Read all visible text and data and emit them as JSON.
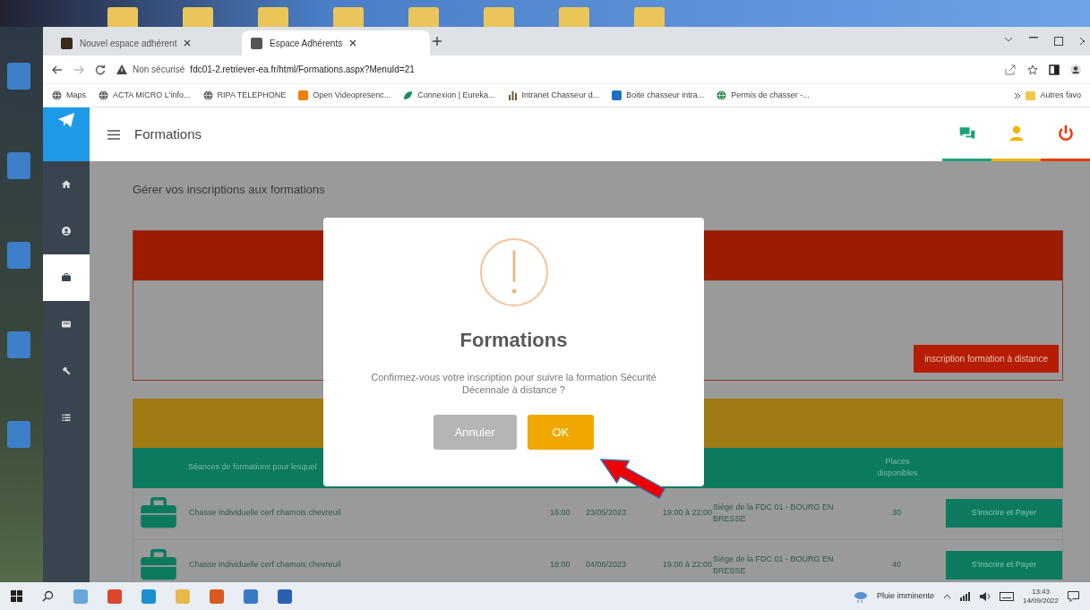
{
  "browser": {
    "tabs": [
      {
        "title": "Nouvel espace adhérent",
        "selected": false
      },
      {
        "title": "Espace Adhérents",
        "selected": true
      }
    ],
    "security": "Non sécurisé",
    "url": "fdc01-2.retriever-ea.fr/html/Formations.aspx?MenuId=21",
    "bookmarks": [
      {
        "label": "Maps",
        "kind": "globe",
        "color": "#5f6368"
      },
      {
        "label": "ACTA MICRO L'info...",
        "kind": "globe",
        "color": "#5f6368"
      },
      {
        "label": "RIPA TELEPHONE",
        "kind": "globe",
        "color": "#5f6368"
      },
      {
        "label": "Open Videopresenc...",
        "kind": "square",
        "color": "#f07c00"
      },
      {
        "label": "Connexion | Eureka...",
        "kind": "leaf",
        "color": "#1a8f5a"
      },
      {
        "label": "Intranet Chasseur d...",
        "kind": "chart",
        "color": "#6b5a2a"
      },
      {
        "label": "Boite chasseur intra...",
        "kind": "square",
        "color": "#1f6fc4"
      },
      {
        "label": "Permis de chasser -...",
        "kind": "globe",
        "color": "#2a8a4a"
      }
    ],
    "other_bookmarks": "Autres favo"
  },
  "app": {
    "sidebar": {
      "items": [
        {
          "selected": false
        },
        {
          "selected": false
        },
        {
          "selected": true
        },
        {
          "selected": false
        },
        {
          "selected": false
        },
        {
          "selected": false
        }
      ]
    },
    "header": {
      "title": "Formations",
      "actions": [
        {
          "color": "#1aa37a"
        },
        {
          "color": "#f0b400"
        },
        {
          "color": "#e8380d"
        }
      ]
    },
    "subtitle": "Gérer vos inscriptions aux formations",
    "distance_panel": {
      "button": "inscription formation à distance"
    },
    "sessions_panel": {
      "title_column": "Séances de formations pour lesquel",
      "places_column": "Places disponibles",
      "rows": [
        {
          "title": "Chasse individuelle cerf chamois chevreuil",
          "time": "16:00",
          "date": "23/05/2023",
          "hours": "19:00 à 22:00",
          "location": "Siège de la FDC 01 - BOURG EN BRESSE",
          "places": "30",
          "button": "S'inscrire et Payer"
        },
        {
          "title": "Chasse individuelle cerf chamois chevreuil",
          "time": "18:00",
          "date": "04/06/2023",
          "hours": "19:00 à 22:00",
          "location": "Siège de la FDC 01 - BOURG EN BRESSE",
          "places": "40",
          "button": "S'inscrire et Payer"
        }
      ]
    }
  },
  "dialog": {
    "title": "Formations",
    "message": "Confirmez-vous votre inscription pour suivre la formation Sécurité Décennale à distance ?",
    "buttons": [
      {
        "label": "Annuler",
        "kind": "cancel"
      },
      {
        "label": "OK",
        "kind": "confirm"
      }
    ]
  },
  "taskbar": {
    "weather": "Pluie imminente",
    "time": "13:43",
    "date": "14/09/2022"
  }
}
